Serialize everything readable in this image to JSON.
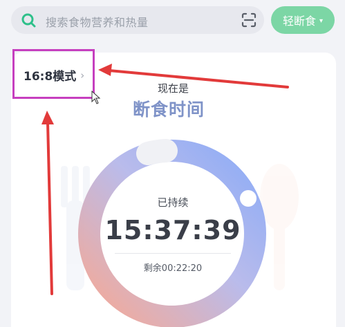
{
  "search": {
    "placeholder": "搜索食物营养和热量",
    "icon": "search-icon",
    "scan_icon": "scan-icon"
  },
  "mode_pill": {
    "label": "轻断食",
    "caret": "▾",
    "color": "#7cd6a5"
  },
  "plan": {
    "label": "16:8模式",
    "chevron": "›"
  },
  "status": {
    "prefix": "现在是",
    "title": "断食时间"
  },
  "timer": {
    "elapsed_label": "已持续",
    "elapsed": "15:37:39",
    "remaining": "剩余00:22:20",
    "progress": 0.984
  },
  "colors": {
    "ring_start": "#f6a48f",
    "ring_end": "#86a7f6",
    "accent": "#7cd6a5",
    "annotation": "#e23a3a",
    "highlight": "#c63fbf"
  }
}
